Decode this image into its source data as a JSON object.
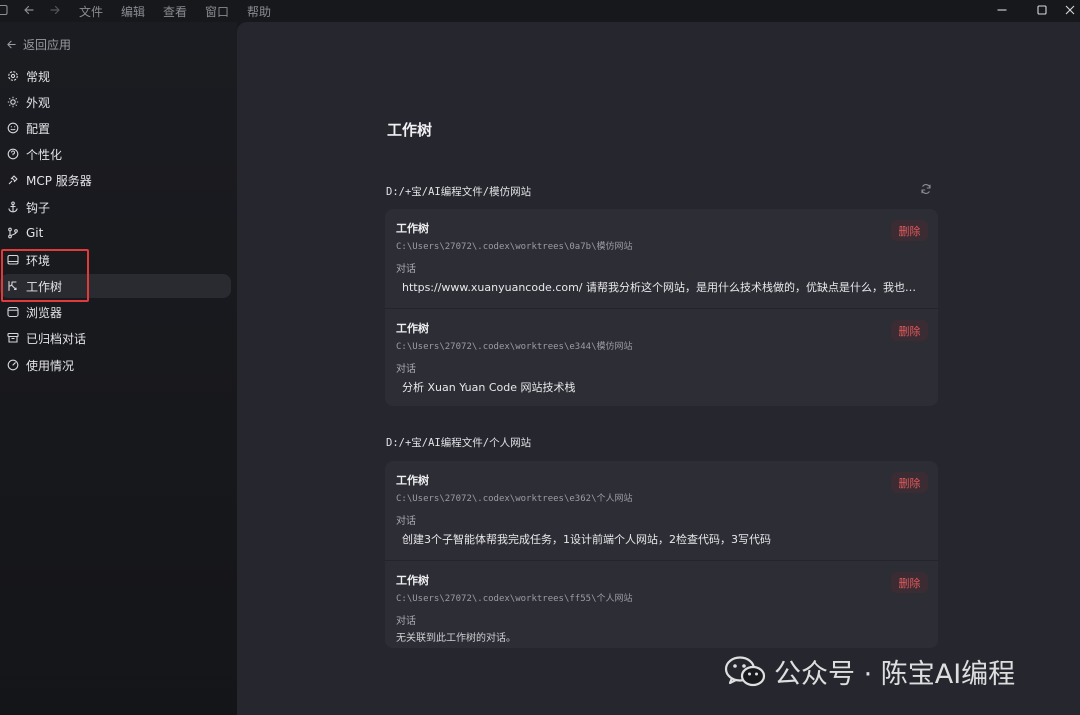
{
  "titlebar": {
    "menu": [
      "文件",
      "编辑",
      "查看",
      "窗口",
      "帮助"
    ]
  },
  "sidebar": {
    "back_label": "返回应用",
    "items": [
      {
        "label": "常规",
        "icon": "gear-icon"
      },
      {
        "label": "外观",
        "icon": "sun-icon"
      },
      {
        "label": "配置",
        "icon": "smile-icon"
      },
      {
        "label": "个性化",
        "icon": "personalize-icon"
      },
      {
        "label": "MCP 服务器",
        "icon": "plug-icon"
      },
      {
        "label": "钩子",
        "icon": "anchor-icon"
      },
      {
        "label": "Git",
        "icon": "git-branch-icon"
      },
      {
        "label": "环境",
        "icon": "monitor-icon"
      },
      {
        "label": "工作树",
        "icon": "worktree-icon",
        "active": true
      },
      {
        "label": "浏览器",
        "icon": "browser-icon"
      },
      {
        "label": "已归档对话",
        "icon": "archive-icon"
      },
      {
        "label": "使用情况",
        "icon": "gauge-icon"
      }
    ]
  },
  "main": {
    "title": "工作树",
    "groups": [
      {
        "path": "D:/+宝/AI编程文件/模仿网站",
        "entries": [
          {
            "title": "工作树",
            "path": "C:\\Users\\27072\\.codex\\worktrees\\0a7b\\模仿网站",
            "convo_label": "对话",
            "convo": "https://www.xuanyuancode.com/ 请帮我分析这个网站，是用什么技术栈做的，优缺点是什么，我也想做一...",
            "delete_label": "删除"
          },
          {
            "title": "工作树",
            "path": "C:\\Users\\27072\\.codex\\worktrees\\e344\\模仿网站",
            "convo_label": "对话",
            "convo": "分析 Xuan Yuan Code 网站技术栈",
            "delete_label": "删除"
          }
        ]
      },
      {
        "path": "D:/+宝/AI编程文件/个人网站",
        "entries": [
          {
            "title": "工作树",
            "path": "C:\\Users\\27072\\.codex\\worktrees\\e362\\个人网站",
            "convo_label": "对话",
            "convo": "创建3个子智能体帮我完成任务，1设计前端个人网站，2检查代码，3写代码",
            "delete_label": "删除"
          },
          {
            "title": "工作树",
            "path": "C:\\Users\\27072\\.codex\\worktrees\\ff55\\个人网站",
            "convo_label": "对话",
            "empty_text": "无关联到此工作树的对话。",
            "delete_label": "删除"
          }
        ]
      }
    ]
  },
  "watermark": {
    "text": "公众号 · 陈宝AI编程"
  },
  "colors": {
    "background": "#17181c",
    "panel": "#25262e",
    "card": "#2c2d35",
    "danger": "#e3595c",
    "highlight": "#e03a3a"
  }
}
